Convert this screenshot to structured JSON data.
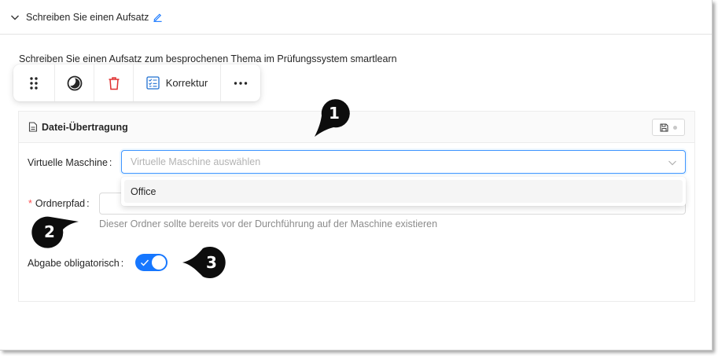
{
  "section": {
    "title": "Schreiben Sie einen Aufsatz",
    "chevron_icon": "chevron-down-icon",
    "edit_icon": "pencil-edit-icon"
  },
  "description": "Schreiben Sie einen Aufsatz zum besprochenen Thema im Prüfungssystem smartlearn",
  "toolbar": {
    "drag_icon": "drag-handle-icon",
    "theme_icon": "contrast-icon",
    "delete_icon": "trash-icon",
    "correction_label": "Korrektur",
    "correction_icon": "checklist-icon",
    "more_icon": "more-horizontal-icon"
  },
  "panel": {
    "title": "Datei-Übertragung",
    "title_icon": "file-icon",
    "save_icon": "save-icon"
  },
  "form": {
    "vm_label": "Virtuelle Maschine",
    "vm_placeholder": "Virtuelle Maschine auswählen",
    "vm_options": [
      "Office"
    ],
    "path_label": "Ordnerpfad",
    "path_required_mark": "*",
    "path_hint": "Dieser Ordner sollte bereits vor der Durchführung auf der Maschine existieren",
    "submission_label": "Abgabe obligatorisch",
    "submission_enabled": true,
    "label_colon": ":"
  },
  "markers": [
    "1",
    "2",
    "3"
  ],
  "colors": {
    "accent": "#1677ff",
    "required": "#ff4d4f",
    "delete": "#e03131",
    "correction": "#1f6fd1",
    "marker": "#0d0d0d"
  }
}
